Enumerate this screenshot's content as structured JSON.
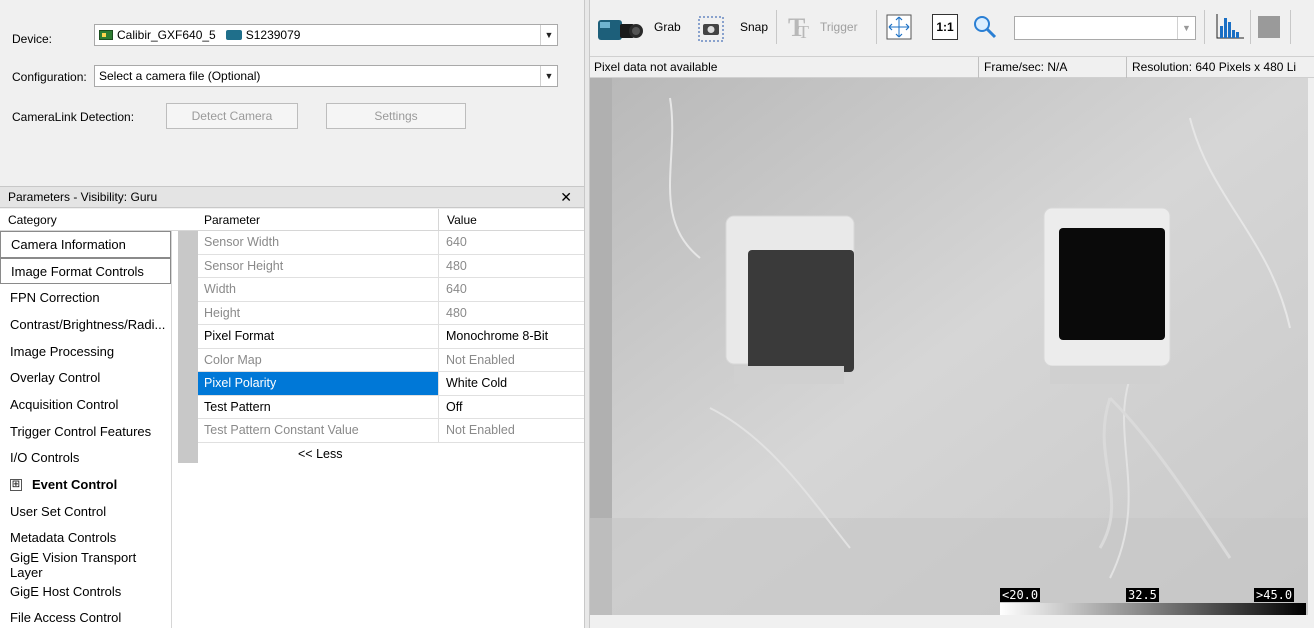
{
  "device": {
    "label": "Device:",
    "name": "Calibir_GXF640_5",
    "serial": "S1239079"
  },
  "configuration": {
    "label": "Configuration:",
    "value": "Select a camera file (Optional)"
  },
  "cameralink": {
    "label": "CameraLink Detection:",
    "detect_label": "Detect Camera",
    "settings_label": "Settings"
  },
  "params_panel": {
    "title": "Parameters - Visibility: Guru",
    "close": "✕",
    "category_header": "Category",
    "parameter_header": "Parameter",
    "value_header": "Value",
    "less_link": "<< Less"
  },
  "categories": [
    {
      "label": "Camera Information"
    },
    {
      "label": "Image Format Controls"
    },
    {
      "label": "FPN Correction"
    },
    {
      "label": "Contrast/Brightness/Radi..."
    },
    {
      "label": "Image Processing"
    },
    {
      "label": "Overlay Control"
    },
    {
      "label": "Acquisition Control"
    },
    {
      "label": "Trigger Control Features"
    },
    {
      "label": "I/O Controls"
    },
    {
      "label": "Event Control",
      "expander": "⊞"
    },
    {
      "label": "User Set Control"
    },
    {
      "label": "Metadata Controls"
    },
    {
      "label": "GigE Vision Transport Layer"
    },
    {
      "label": "GigE Host Controls"
    },
    {
      "label": "File Access Control"
    }
  ],
  "parameters": [
    {
      "name": "Sensor Width",
      "value": "640",
      "enabled": false
    },
    {
      "name": "Sensor Height",
      "value": "480",
      "enabled": false
    },
    {
      "name": "Width",
      "value": "640",
      "enabled": false
    },
    {
      "name": "Height",
      "value": "480",
      "enabled": false
    },
    {
      "name": "Pixel Format",
      "value": "Monochrome 8-Bit",
      "enabled": true
    },
    {
      "name": "Color Map",
      "value": "Not Enabled",
      "enabled": false
    },
    {
      "name": "Pixel Polarity",
      "value": "White Cold",
      "enabled": true,
      "selected": true
    },
    {
      "name": "Test Pattern",
      "value": "Off",
      "enabled": true
    },
    {
      "name": "Test Pattern Constant Value",
      "value": "Not Enabled",
      "enabled": false
    }
  ],
  "toolbar": {
    "grab": "Grab",
    "snap": "Snap",
    "trigger": "Trigger",
    "one_to_one": "1:1",
    "zoom_value": ""
  },
  "status": {
    "pixel": "Pixel data not available",
    "fps": "Frame/sec: N/A",
    "resolution": "Resolution: 640 Pixels x 480 Li"
  },
  "scale": {
    "min": "<20.0",
    "mid": "32.5",
    "max": ">45.0"
  },
  "colors": {
    "selection": "#0078d7",
    "window_bg": "#f0f0f0"
  }
}
